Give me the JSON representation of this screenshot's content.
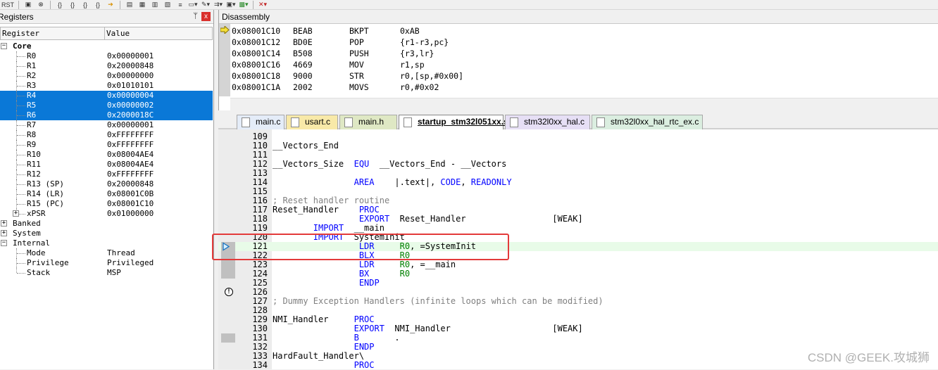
{
  "toolbar": {
    "rst_label": "RST",
    "buttons": [
      "new-window-icon",
      "stop-icon",
      "step-into-icon",
      "step-over-icon",
      "step-out-icon",
      "run-to-cursor-icon",
      "show-next-icon",
      "command-window-icon",
      "disassembly-window-icon",
      "symbols-window-icon",
      "registers-window-icon",
      "call-stack-icon",
      "watch-window-icon",
      "memory-window-icon",
      "serial-window-icon",
      "analysis-window-icon",
      "trace-icon",
      "system-viewer-icon",
      "toolbox-icon"
    ]
  },
  "registers": {
    "title": "Registers",
    "pin_icon": "pin-icon",
    "close_label": "x",
    "col_register": "Register",
    "col_value": "Value",
    "groups": [
      {
        "label": "Core",
        "expanded": true
      },
      {
        "label": "Banked",
        "expanded": false
      },
      {
        "label": "System",
        "expanded": false
      },
      {
        "label": "Internal",
        "expanded": true
      }
    ],
    "core": [
      {
        "name": "R0",
        "value": "0x00000001",
        "selected": false
      },
      {
        "name": "R1",
        "value": "0x20000848",
        "selected": false
      },
      {
        "name": "R2",
        "value": "0x00000000",
        "selected": false
      },
      {
        "name": "R3",
        "value": "0x01010101",
        "selected": false
      },
      {
        "name": "R4",
        "value": "0x00000004",
        "selected": true
      },
      {
        "name": "R5",
        "value": "0x00000002",
        "selected": true
      },
      {
        "name": "R6",
        "value": "0x2000018C",
        "selected": true
      },
      {
        "name": "R7",
        "value": "0x00000001",
        "selected": false
      },
      {
        "name": "R8",
        "value": "0xFFFFFFFF",
        "selected": false
      },
      {
        "name": "R9",
        "value": "0xFFFFFFFF",
        "selected": false
      },
      {
        "name": "R10",
        "value": "0x08004AE4",
        "selected": false
      },
      {
        "name": "R11",
        "value": "0x08004AE4",
        "selected": false
      },
      {
        "name": "R12",
        "value": "0xFFFFFFFF",
        "selected": false
      },
      {
        "name": "R13 (SP)",
        "value": "0x20000848",
        "selected": false
      },
      {
        "name": "R14 (LR)",
        "value": "0x08001C0B",
        "selected": false
      },
      {
        "name": "R15 (PC)",
        "value": "0x08001C10",
        "selected": false
      },
      {
        "name": "xPSR",
        "value": "0x01000000",
        "selected": false
      }
    ],
    "internal": [
      {
        "name": "Mode",
        "value": "Thread"
      },
      {
        "name": "Privilege",
        "value": "Privileged"
      },
      {
        "name": "Stack",
        "value": "MSP"
      }
    ]
  },
  "disassembly": {
    "title": "Disassembly",
    "lines": [
      {
        "addr": "0x08001C10",
        "hex": "BEAB",
        "op": "BKPT",
        "args": "0xAB"
      },
      {
        "addr": "0x08001C12",
        "hex": "BD0E",
        "op": "POP",
        "args": "{r1-r3,pc}"
      },
      {
        "addr": "0x08001C14",
        "hex": "B508",
        "op": "PUSH",
        "args": "{r3,lr}"
      },
      {
        "addr": "0x08001C16",
        "hex": "4669",
        "op": "MOV",
        "args": "r1,sp"
      },
      {
        "addr": "0x08001C18",
        "hex": "9000",
        "op": "STR",
        "args": "r0,[sp,#0x00]"
      },
      {
        "addr": "0x08001C1A",
        "hex": "2002",
        "op": "MOVS",
        "args": "r0,#0x02"
      }
    ]
  },
  "tabs": [
    {
      "label": "main.c",
      "active": false,
      "color": "#e4ecf8"
    },
    {
      "label": "usart.c",
      "active": false,
      "color": "#f8e9a8"
    },
    {
      "label": "main.h",
      "active": false,
      "color": "#dfe8c4"
    },
    {
      "label": "startup_stm32l051xx.s",
      "active": true,
      "color": "#ffffff"
    },
    {
      "label": "stm32l0xx_hal.c",
      "active": false,
      "color": "#e6dff5"
    },
    {
      "label": "stm32l0xx_hal_rtc_ex.c",
      "active": false,
      "color": "#dbeee0"
    }
  ],
  "editor": {
    "lines": [
      {
        "no": "109",
        "code": ""
      },
      {
        "no": "110",
        "code": "__Vectors_End"
      },
      {
        "no": "111",
        "code": ""
      },
      {
        "no": "112",
        "code": "__Vectors_Size  EQU  __Vectors_End - __Vectors"
      },
      {
        "no": "113",
        "code": ""
      },
      {
        "no": "114",
        "code": "                AREA    |.text|, CODE, READONLY"
      },
      {
        "no": "115",
        "code": ""
      },
      {
        "no": "116",
        "code": "; Reset handler routine"
      },
      {
        "no": "117",
        "code": "Reset_Handler    PROC"
      },
      {
        "no": "118",
        "code": "                 EXPORT  Reset_Handler                 [WEAK]"
      },
      {
        "no": "119",
        "code": "        IMPORT  __main"
      },
      {
        "no": "120",
        "code": "        IMPORT  SystemInit"
      },
      {
        "no": "121",
        "code": "                 LDR     R0, =SystemInit"
      },
      {
        "no": "122",
        "code": "                 BLX     R0"
      },
      {
        "no": "123",
        "code": "                 LDR     R0, =__main"
      },
      {
        "no": "124",
        "code": "                 BX      R0"
      },
      {
        "no": "125",
        "code": "                 ENDP"
      },
      {
        "no": "126",
        "code": ""
      },
      {
        "no": "127",
        "code": "; Dummy Exception Handlers (infinite loops which can be modified)"
      },
      {
        "no": "128",
        "code": ""
      },
      {
        "no": "129",
        "code": "NMI_Handler     PROC"
      },
      {
        "no": "130",
        "code": "                EXPORT  NMI_Handler                    [WEAK]"
      },
      {
        "no": "131",
        "code": "                B       ."
      },
      {
        "no": "132",
        "code": "                ENDP"
      },
      {
        "no": "133",
        "code": "HardFault_Handler\\"
      },
      {
        "no": "134",
        "code": "                PROC"
      }
    ]
  },
  "watermark": "CSDN @GEEK.攻城狮"
}
